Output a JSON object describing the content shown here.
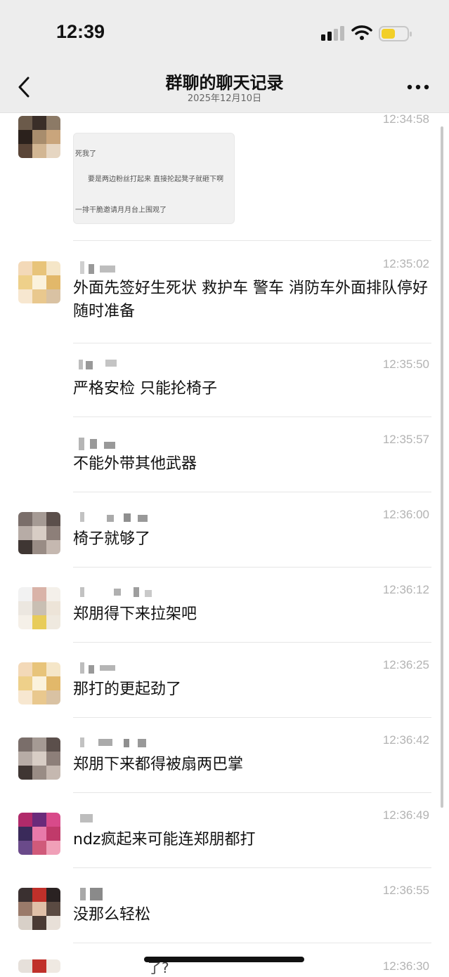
{
  "status": {
    "time": "12:39"
  },
  "nav": {
    "title": "群聊的聊天记录",
    "subtitle": "2025年12月10日"
  },
  "image_card": {
    "lines": [
      "死我了",
      "要是两边粉丝打起来 直接抡起凳子就砸下啊",
      "一排干脆邀请月月台上围观了"
    ]
  },
  "messages": [
    {
      "time": "12:34:58"
    },
    {
      "time": "12:35:02",
      "text": "外面先签好生死状   救护车 警车 消防车外面排队停好  随时准备"
    },
    {
      "time": "12:35:50",
      "text": "严格安检  只能抡椅子"
    },
    {
      "time": "12:35:57",
      "text": "不能外带其他武器"
    },
    {
      "time": "12:36:00",
      "text": "椅子就够了"
    },
    {
      "time": "12:36:12",
      "text": "郑朋得下来拉架吧"
    },
    {
      "time": "12:36:25",
      "text": "那打的更起劲了"
    },
    {
      "time": "12:36:42",
      "text": "郑朋下来都得被扇两巴掌"
    },
    {
      "time": "12:36:49",
      "text": "ndz疯起来可能连郑朋都打"
    },
    {
      "time": "12:36:55",
      "text": "没那么轻松"
    },
    {
      "time": "12:36:30",
      "text": "了?"
    }
  ]
}
